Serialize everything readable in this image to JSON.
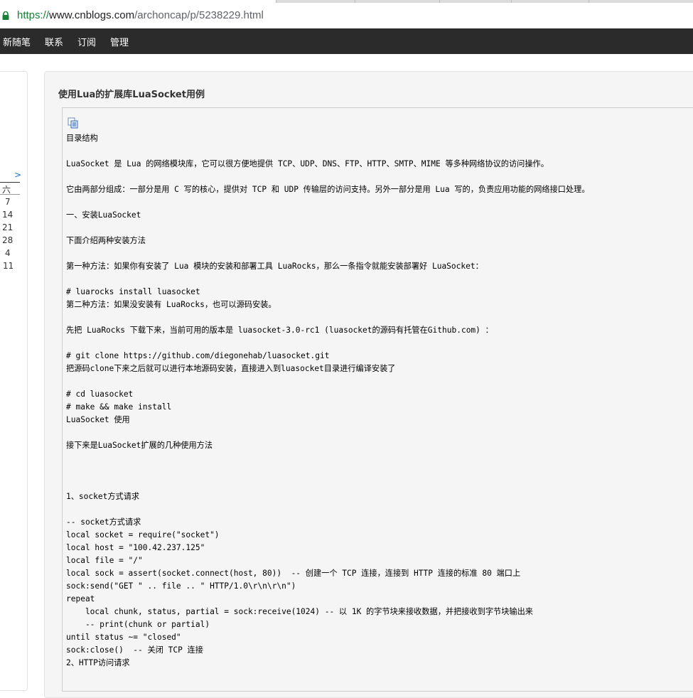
{
  "browser": {
    "url_scheme": "https://",
    "url_host": "www.cnblogs.com",
    "url_path": "/archoncap/p/5238229.html"
  },
  "nav": {
    "items": [
      "新随笔",
      "联系",
      "订阅",
      "管理"
    ]
  },
  "calendar": {
    "arrow": ">",
    "header": "六",
    "days": [
      "7",
      "14",
      "21",
      "28",
      "4",
      "11"
    ]
  },
  "post": {
    "title": "使用Lua的扩展库LuaSocket用例"
  },
  "code_lines": [
    "目录结构",
    "LuaSocket 是 Lua 的网络模块库，它可以很方便地提供 TCP、UDP、DNS、FTP、HTTP、SMTP、MIME 等多种网络协议的访问操作。",
    "它由两部分组成：一部分是用 C 写的核心，提供对 TCP 和 UDP 传输层的访问支持。另外一部分是用 Lua 写的，负责应用功能的网络接口处理。",
    "一、安装LuaSocket",
    "下面介绍两种安装方法",
    "第一种方法：如果你有安装了 Lua 模块的安装和部署工具 LuaRocks，那么一条指令就能安装部署好 LuaSocket：",
    "# luarocks install luasocket",
    "第二种方法：如果没安装有 LuaRocks，也可以源码安装。",
    "先把 LuaRocks 下载下来，当前可用的版本是 luasocket-3.0-rc1 (luasocket的源码有托管在Github.com) ：",
    "# git clone https://github.com/diegonehab/luasocket.git",
    "把源码clone下来之后就可以进行本地源码安装，直接进入到luasocket目录进行编译安装了",
    "# cd luasocket",
    "# make && make install",
    "LuaSocket 使用",
    "接下来是LuaSocket扩展的几种使用方法",
    "1、socket方式请求",
    "-- socket方式请求",
    "local socket = require(\"socket\")",
    "local host = \"100.42.237.125\"",
    "local file = \"/\"",
    "local sock = assert(socket.connect(host, 80))  -- 创建一个 TCP 连接，连接到 HTTP 连接的标准 80 端口上",
    "sock:send(\"GET \" .. file .. \" HTTP/1.0\\r\\n\\r\\n\")",
    "repeat",
    "    local chunk, status, partial = sock:receive(1024) -- 以 1K 的字节块来接收数据，并把接收到字节块输出来",
    "    -- print(chunk or partial)",
    "until status ~= \"closed\"",
    "sock:close()  -- 关闭 TCP 连接",
    "2、HTTP访问请求"
  ],
  "colors": {
    "nav_bg": "#2b2b2b",
    "panel_bg": "#f5f5f5",
    "link_blue": "#1a6fd0",
    "secure_green": "#188038"
  }
}
